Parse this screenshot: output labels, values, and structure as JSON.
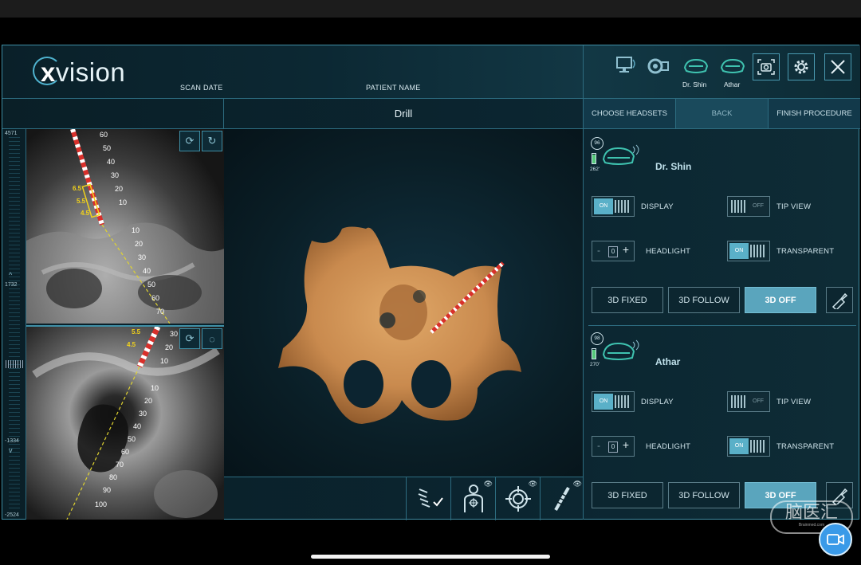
{
  "app": {
    "logo": "xvision",
    "scan_date_label": "SCAN DATE",
    "patient_name_label": "PATIENT NAME",
    "view_title": "Drill"
  },
  "header": {
    "headsets": [
      {
        "name": "Dr. Shin"
      },
      {
        "name": "Athar"
      }
    ],
    "icons": [
      "monitor-icon",
      "camera-tracker-icon",
      "headset-icon",
      "screenshot-icon",
      "gear-icon",
      "close-icon"
    ]
  },
  "nav": {
    "choose_headsets": "CHOOSE HEADSETS",
    "back": "BACK",
    "finish_procedure": "FINISH PROCEDURE"
  },
  "scale": {
    "top": "4571",
    "mid": "1732",
    "low": "-1334",
    "bottom": "-2524"
  },
  "ct_top": {
    "probe_ticks": [
      "60",
      "50",
      "40",
      "30",
      "20",
      "10"
    ],
    "yellow_ticks": [
      "6.5",
      "5.5",
      "4.5"
    ],
    "trajectory_ticks": [
      "10",
      "20",
      "30",
      "40",
      "50",
      "60",
      "70"
    ]
  },
  "ct_bottom": {
    "probe_ticks": [
      "30",
      "20",
      "10"
    ],
    "yellow_ticks": [
      "5.5",
      "4.5"
    ],
    "trajectory_ticks": [
      "10",
      "20",
      "30",
      "40",
      "50",
      "60",
      "70",
      "80",
      "90",
      "100"
    ]
  },
  "panel": {
    "headsets": [
      {
        "name": "Dr. Shin",
        "battery_pct": "96",
        "battery_time": "262'",
        "display_label": "DISPLAY",
        "tip_view_label": "TIP VIEW",
        "headlight_label": "HEADLIGHT",
        "transparent_label": "TRANSPARENT",
        "display_state": "ON",
        "tip_view_state": "OFF",
        "transparent_state": "ON",
        "headlight_value": "0",
        "mode_fixed": "3D FIXED",
        "mode_follow": "3D FOLLOW",
        "mode_off": "3D OFF",
        "active_mode": "3D OFF"
      },
      {
        "name": "Athar",
        "battery_pct": "98",
        "battery_time": "270'",
        "display_label": "DISPLAY",
        "tip_view_label": "TIP VIEW",
        "headlight_label": "HEADLIGHT",
        "transparent_label": "TRANSPARENT",
        "display_state": "ON",
        "tip_view_state": "OFF",
        "transparent_state": "ON",
        "headlight_value": "0",
        "mode_fixed": "3D FIXED",
        "mode_follow": "3D FOLLOW",
        "mode_off": "3D OFF",
        "active_mode": "3D OFF"
      }
    ]
  },
  "watermark": {
    "text": "脑医汇",
    "sub": "Brainmed.com"
  },
  "colors": {
    "accent": "#5aa5bd",
    "border": "#2d6c80",
    "bone": "#c98a4e",
    "probe_red": "#d9302b",
    "probe_yellow": "#f2d21b",
    "headset_green": "#3fc3b0"
  }
}
